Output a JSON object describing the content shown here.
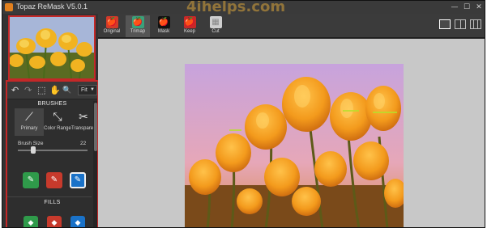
{
  "window": {
    "title": "Topaz ReMask V5.0.1",
    "controls": {
      "minimize": "—",
      "maximize": "☐",
      "close": "✕"
    }
  },
  "watermark": "4ihelps.com",
  "toolbar": {
    "undo_icon": "↶",
    "redo_icon": "↷",
    "select_icon": "⬚",
    "hand_icon": "✋",
    "zoom_icon": "🔍",
    "zoom_value": "Fit",
    "zoom_arrow": "▼"
  },
  "brushes": {
    "title": "BRUSHES",
    "items": [
      {
        "label": "Primary",
        "icon": "⟋"
      },
      {
        "label": "Color Range",
        "icon": "⤡"
      },
      {
        "label": "Transparency",
        "icon": "✂"
      }
    ],
    "size_label": "Brush Size",
    "size_value": "22",
    "size_fraction": 0.22
  },
  "mode_buttons": [
    {
      "name": "keep-brush",
      "icon": "✎",
      "color": "#2f9a4a"
    },
    {
      "name": "cut-brush",
      "icon": "✎",
      "color": "#c73a2c"
    },
    {
      "name": "compute-brush",
      "icon": "✎",
      "color": "#1a72c8"
    }
  ],
  "fills": {
    "title": "FILLS",
    "items": [
      {
        "name": "keep-fill",
        "icon": "◆",
        "color": "#2f9a4a"
      },
      {
        "name": "cut-fill",
        "icon": "◆",
        "color": "#c73a2c"
      },
      {
        "name": "compute-fill",
        "icon": "◆",
        "color": "#1a72c8"
      }
    ]
  },
  "view_tabs": [
    {
      "label": "Original",
      "icon": "🍎",
      "color": "#d23a2a"
    },
    {
      "label": "Trimap",
      "icon": "🍎",
      "color": "#3aa07a"
    },
    {
      "label": "Mask",
      "icon": "🍎",
      "color": "#111111"
    },
    {
      "label": "Keep",
      "icon": "🍎",
      "color": "#c82828"
    },
    {
      "label": "Cut",
      "icon": "▦",
      "color": "#cfcfcf"
    }
  ],
  "colors": {
    "window_bg": "#2b2b2b",
    "canvas_bg": "#c8c8c8",
    "highlight_border": "#c42828"
  }
}
